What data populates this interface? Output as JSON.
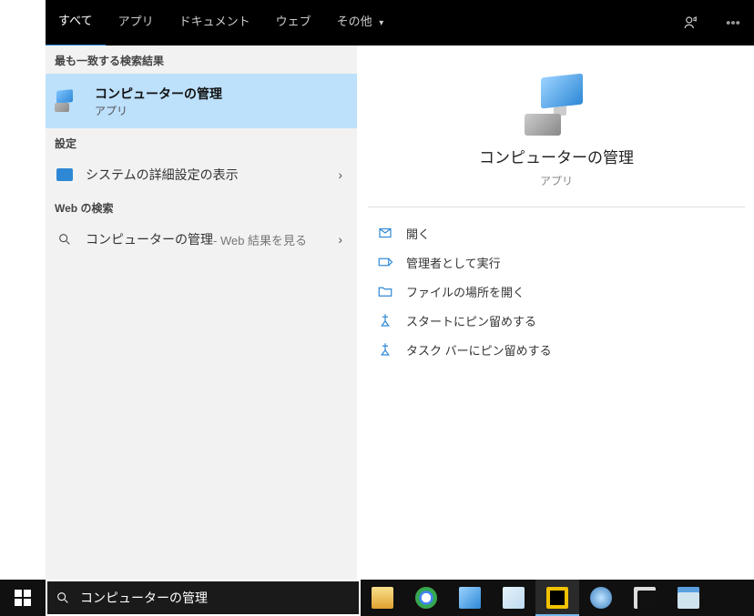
{
  "nav": {
    "tabs": [
      "すべて",
      "アプリ",
      "ドキュメント",
      "ウェブ",
      "その他"
    ],
    "active": 0
  },
  "results": {
    "best_match_header": "最も一致する検索結果",
    "best": {
      "title": "コンピューターの管理",
      "subtitle": "アプリ"
    },
    "settings_header": "設定",
    "settings": [
      {
        "label": "システムの詳細設定の表示"
      }
    ],
    "web_header": "Web の検索",
    "web": [
      {
        "label": "コンピューターの管理",
        "hint": " - Web 結果を見る"
      }
    ]
  },
  "preview": {
    "title": "コンピューターの管理",
    "subtitle": "アプリ",
    "actions": [
      {
        "id": "open",
        "label": "開く"
      },
      {
        "id": "run-admin",
        "label": "管理者として実行"
      },
      {
        "id": "open-loc",
        "label": "ファイルの場所を開く"
      },
      {
        "id": "pin-start",
        "label": "スタートにピン留めする"
      },
      {
        "id": "pin-taskbar",
        "label": "タスク バーにピン留めする"
      }
    ]
  },
  "taskbar": {
    "search_value": "コンピューターの管理",
    "apps": [
      {
        "id": "explorer",
        "color": "#f3c04b"
      },
      {
        "id": "chrome",
        "color": "#ffffff"
      },
      {
        "id": "laptop",
        "color": "#5aa0df"
      },
      {
        "id": "notes",
        "color": "#bcd9ef"
      },
      {
        "id": "app-e",
        "color": "#f2c200",
        "active": true
      },
      {
        "id": "thunderbird",
        "color": "#3a7fbf"
      },
      {
        "id": "terminal",
        "color": "#222222"
      },
      {
        "id": "window",
        "color": "#cfe3ef"
      }
    ]
  }
}
